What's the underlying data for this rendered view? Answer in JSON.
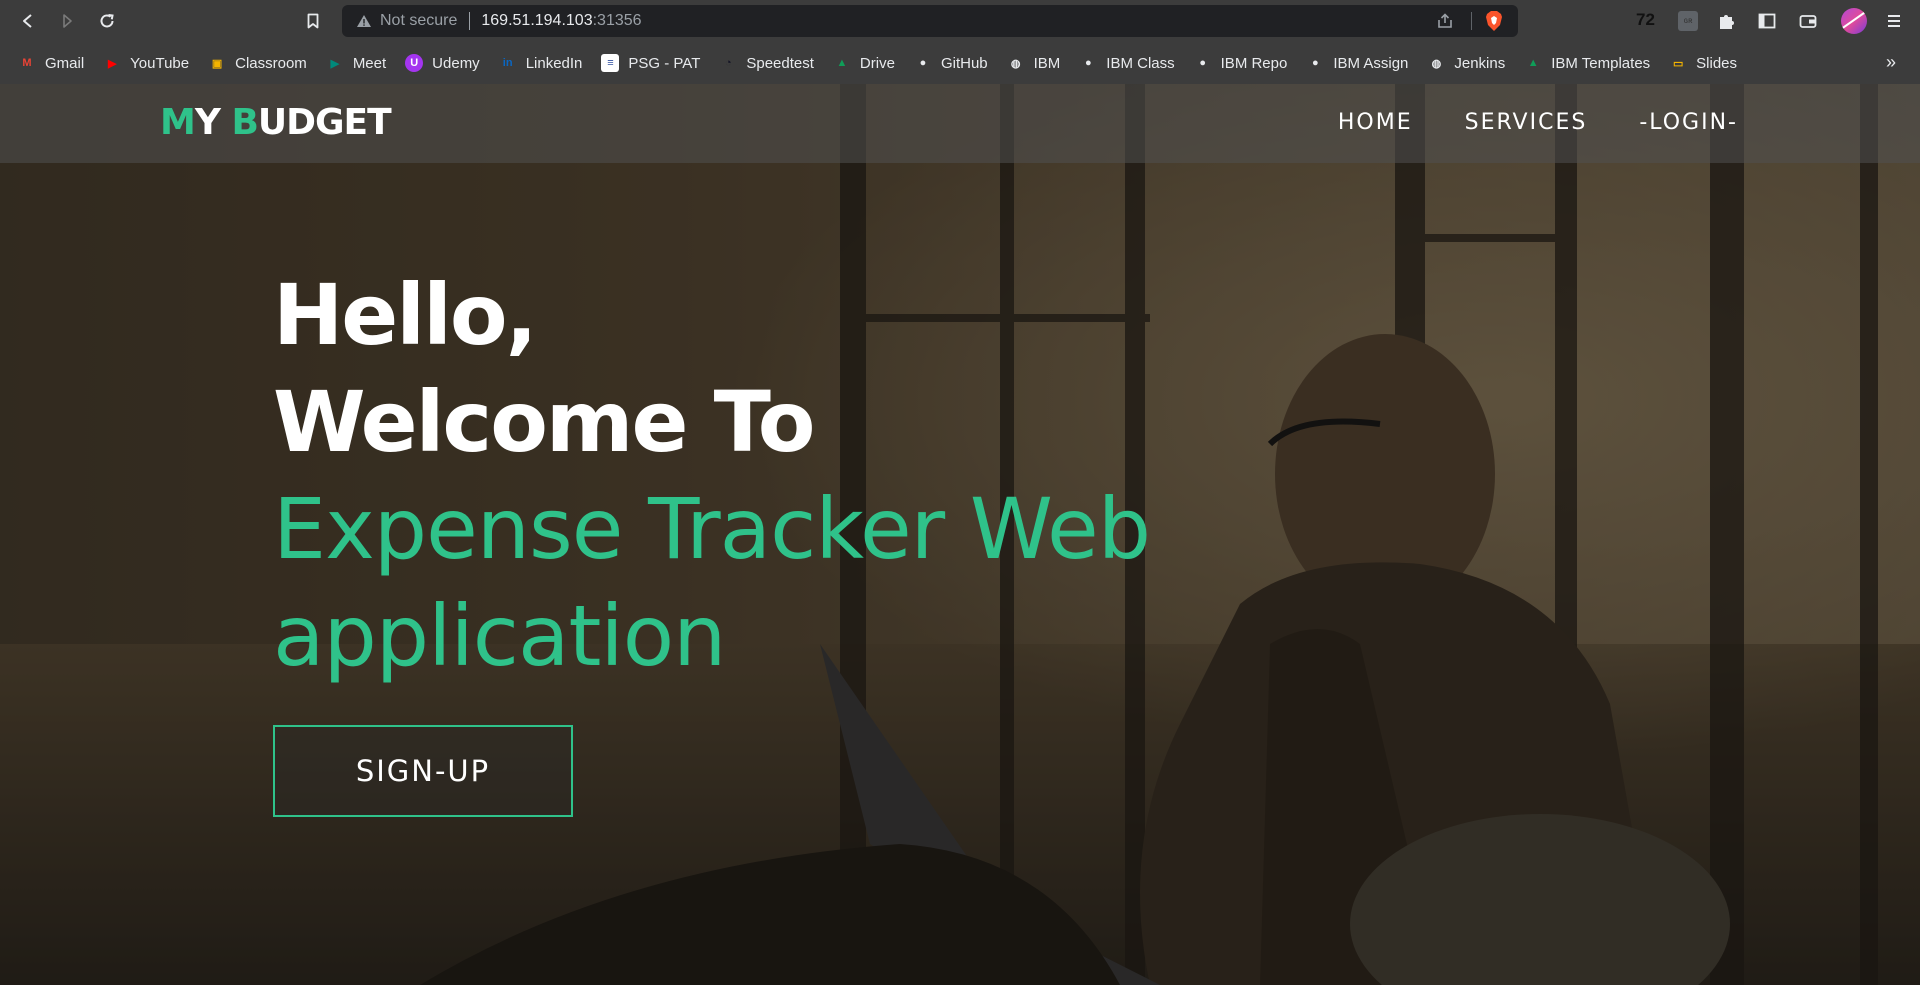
{
  "browser": {
    "security_label": "Not secure",
    "url_host": "169.51.194.103",
    "url_port": ":31356",
    "extension_count": "72",
    "extension_grey_label": "ɢʀ"
  },
  "bookmarks": [
    {
      "label": "Gmail",
      "icon": "gmail-icon",
      "color": "#ea4335",
      "glyph": "M"
    },
    {
      "label": "YouTube",
      "icon": "youtube-icon",
      "color": "#ff0000",
      "glyph": "▶"
    },
    {
      "label": "Classroom",
      "icon": "classroom-icon",
      "color": "#f4b400",
      "glyph": "▣"
    },
    {
      "label": "Meet",
      "icon": "meet-icon",
      "color": "#00897b",
      "glyph": "▶"
    },
    {
      "label": "Udemy",
      "icon": "udemy-icon",
      "color": "#a435f0",
      "glyph": "U"
    },
    {
      "label": "LinkedIn",
      "icon": "linkedin-icon",
      "color": "#0a66c2",
      "glyph": "in"
    },
    {
      "label": "PSG - PAT",
      "icon": "psg-icon",
      "color": "#ffffff",
      "glyph": "≡"
    },
    {
      "label": "Speedtest",
      "icon": "speedtest-icon",
      "color": "#141526",
      "glyph": "◔"
    },
    {
      "label": "Drive",
      "icon": "drive-icon",
      "color": "#0f9d58",
      "glyph": "▲"
    },
    {
      "label": "GitHub",
      "icon": "github-icon",
      "color": "#e8eaed",
      "glyph": "●"
    },
    {
      "label": "IBM",
      "icon": "globe-icon",
      "color": "#e8eaed",
      "glyph": "◍"
    },
    {
      "label": "IBM Class",
      "icon": "github-icon",
      "color": "#e8eaed",
      "glyph": "●"
    },
    {
      "label": "IBM Repo",
      "icon": "github-icon",
      "color": "#e8eaed",
      "glyph": "●"
    },
    {
      "label": "IBM Assign",
      "icon": "github-icon",
      "color": "#e8eaed",
      "glyph": "●"
    },
    {
      "label": "Jenkins",
      "icon": "globe-icon",
      "color": "#e8eaed",
      "glyph": "◍"
    },
    {
      "label": "IBM Templates",
      "icon": "drive-icon",
      "color": "#0f9d58",
      "glyph": "▲"
    },
    {
      "label": "Slides",
      "icon": "slides-icon",
      "color": "#f4b400",
      "glyph": "▭"
    }
  ],
  "site": {
    "logo_m": "M",
    "logo_y": "Y ",
    "logo_b": "B",
    "logo_rest": "UDGET",
    "nav": [
      "HOME",
      "SERVICES",
      "-LOGIN-"
    ],
    "hero_line1": "Hello,",
    "hero_line2": "Welcome To",
    "hero_line3": "Expense Tracker Web",
    "hero_line4": "application",
    "signup_label": "SIGN-UP"
  },
  "colors": {
    "accent": "#2fc28a",
    "chrome": "#3c3c3c",
    "omnibox": "#202124"
  }
}
